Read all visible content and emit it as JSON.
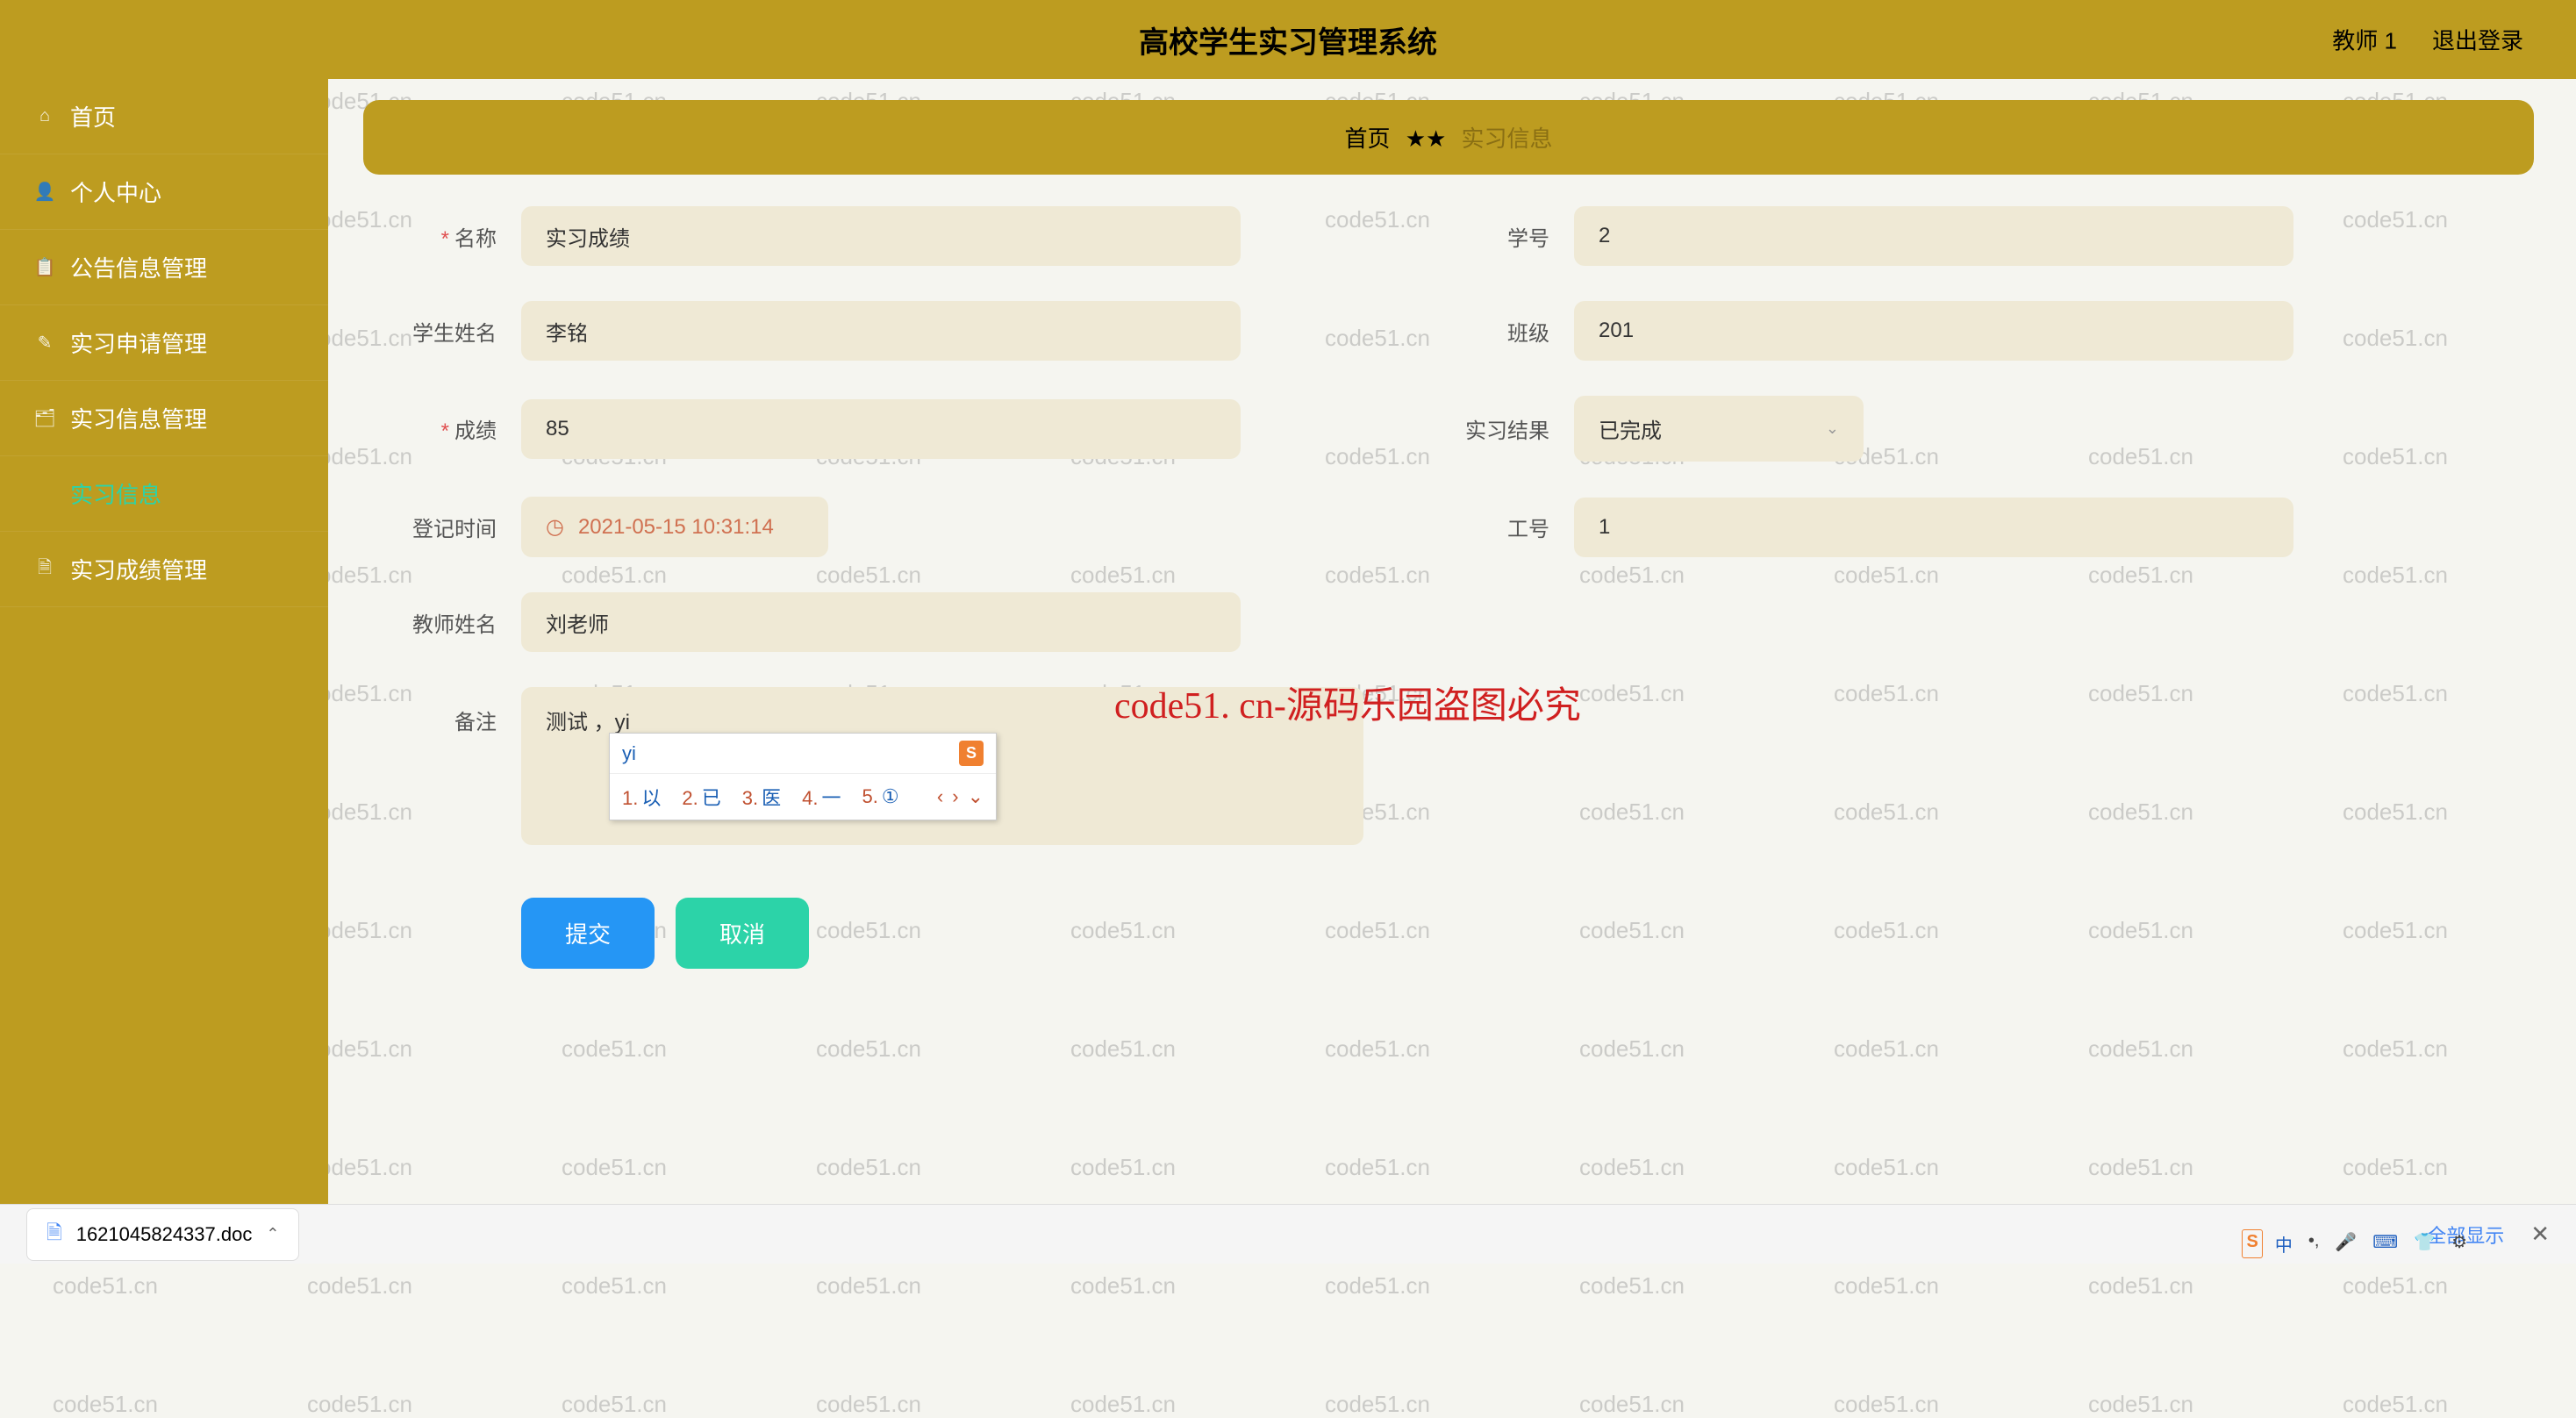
{
  "header": {
    "title": "高校学生实习管理系统",
    "user": "教师 1",
    "logout": "退出登录"
  },
  "sidebar": {
    "items": [
      {
        "icon": "⌂",
        "label": "首页"
      },
      {
        "icon": "👤",
        "label": "个人中心"
      },
      {
        "icon": "📋",
        "label": "公告信息管理"
      },
      {
        "icon": "✎",
        "label": "实习申请管理"
      },
      {
        "icon": "🗂",
        "label": "实习信息管理"
      },
      {
        "icon": "",
        "label": "实习信息",
        "sub": true,
        "active": true
      },
      {
        "icon": "🗎",
        "label": "实习成绩管理"
      }
    ]
  },
  "breadcrumb": {
    "home": "首页",
    "sep": "★★",
    "current": "实习信息"
  },
  "form": {
    "name": {
      "label": "名称",
      "value": "实习成绩"
    },
    "student_no": {
      "label": "学号",
      "value": "2"
    },
    "student_name": {
      "label": "学生姓名",
      "value": "李铭"
    },
    "class": {
      "label": "班级",
      "value": "201"
    },
    "score": {
      "label": "成绩",
      "value": "85"
    },
    "result": {
      "label": "实习结果",
      "value": "已完成"
    },
    "reg_time": {
      "label": "登记时间",
      "value": "2021-05-15 10:31:14"
    },
    "work_no": {
      "label": "工号",
      "value": "1"
    },
    "teacher_name": {
      "label": "教师姓名",
      "value": "刘老师"
    },
    "remark": {
      "label": "备注",
      "value": "测试  ，yi"
    }
  },
  "buttons": {
    "submit": "提交",
    "cancel": "取消"
  },
  "ime": {
    "input": "yi",
    "candidates": [
      {
        "n": "1.",
        "t": "以"
      },
      {
        "n": "2.",
        "t": "已"
      },
      {
        "n": "3.",
        "t": "医"
      },
      {
        "n": "4.",
        "t": "一"
      },
      {
        "n": "5.",
        "t": "①"
      }
    ]
  },
  "overlay": "code51. cn-源码乐园盗图必究",
  "download": {
    "file": "1621045824337.doc",
    "show_all": "全部显示"
  },
  "watermark": "code51.cn"
}
